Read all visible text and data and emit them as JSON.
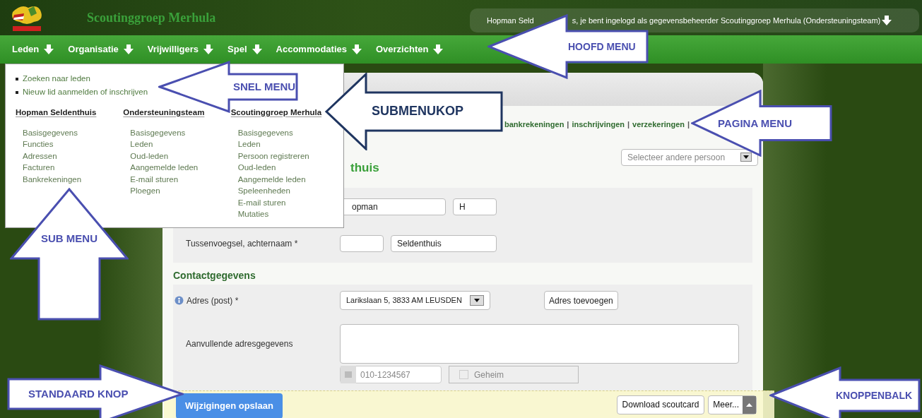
{
  "header": {
    "title": "Scoutinggroep Merhula",
    "user_text_before": "Hopman Seld",
    "user_text_after": "s, je bent ingelogd als gegevensbeheerder Scoutinggroep Merhula (Ondersteuningsteam)"
  },
  "nav": [
    "Leden",
    "Organisatie",
    "Vrijwilligers",
    "Spel",
    "Accommodaties",
    "Overzichten"
  ],
  "dropdown": {
    "quick_links": [
      "Zoeken naar leden",
      "Nieuw lid aanmelden of inschrijven"
    ],
    "columns": [
      {
        "heading": "Hopman Seldenthuis",
        "items": [
          "Basisgegevens",
          "Functies",
          "Adressen",
          "Facturen",
          "Bankrekeningen"
        ]
      },
      {
        "heading": "Ondersteuningsteam",
        "items": [
          "Basisgegevens",
          "Leden",
          "Oud-leden",
          "Aangemelde leden",
          "E-mail sturen",
          "Ploegen"
        ]
      },
      {
        "heading": "Scoutinggroep Merhula",
        "items": [
          "Basisgegevens",
          "Leden",
          "Persoon registreren",
          "Oud-leden",
          "Aangemelde leden",
          "Speleenheden",
          "E-mail sturen",
          "Mutaties"
        ]
      }
    ]
  },
  "page_menu": [
    {
      "label": "bankrekeningen",
      "separator": "|"
    },
    {
      "label": "inschrijvingen",
      "separator": "|"
    },
    {
      "label": "verzekeringen",
      "separator": "|"
    }
  ],
  "page_heading": "thuis",
  "person_select": {
    "placeholder": "Selecteer andere persoon"
  },
  "name_rows": [
    {
      "fields": [
        {
          "kind": "text",
          "value": "opman"
        },
        {
          "kind": "text",
          "value": "H"
        }
      ]
    },
    {
      "label": "Tussenvoegsel, achternaam *",
      "fields": [
        {
          "kind": "text"
        },
        {
          "kind": "text",
          "value": "Seldenthuis"
        }
      ]
    }
  ],
  "contact": {
    "heading": "Contactgegevens",
    "address_label": "Adres (post) *",
    "address_value": "Larikslaan 5, 3833 AM LEUSDEN",
    "add_address": "Adres toevoegen",
    "extra_label": "Aanvullende adresgegevens",
    "phone_placeholder": "010-1234567",
    "secret_label": "Geheim",
    "secret_checked": false
  },
  "button_bar": {
    "save": "Wijzigingen opslaan",
    "download": "Download scoutcard",
    "more": "Meer..."
  },
  "annotations": [
    {
      "label": "HOOFD MENU",
      "kind": "left",
      "color": "#4a4fb0"
    },
    {
      "label": "SNEL MENU",
      "kind": "left",
      "color": "#4a4fb0"
    },
    {
      "label": "SUBMENUKOP",
      "kind": "left",
      "color": "#1f3560"
    },
    {
      "label": "PAGINA MENU",
      "kind": "left",
      "color": "#4a4fb0"
    },
    {
      "label": "SUB MENU",
      "kind": "up",
      "color": "#4a4fb0"
    },
    {
      "label": "STANDAARD KNOP",
      "kind": "right",
      "color": "#4a4fb0"
    },
    {
      "label": "KNOPPENBALK",
      "kind": "left",
      "color": "#4a4fb0"
    }
  ]
}
